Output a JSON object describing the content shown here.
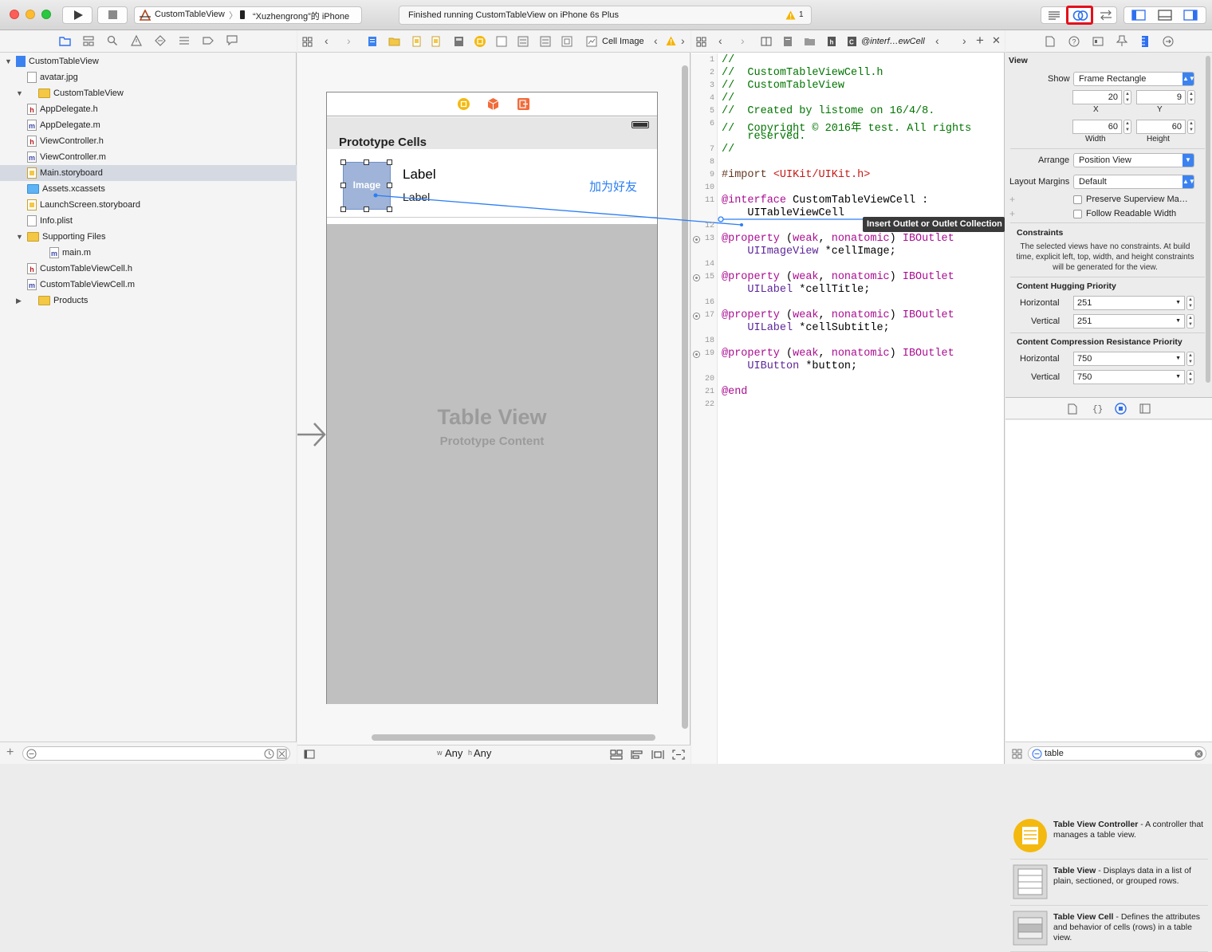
{
  "toolbar": {
    "scheme": "CustomTableView",
    "device": "“Xuzhengrong”的 iPhone",
    "activity": "Finished running CustomTableView on iPhone 6s Plus",
    "warning_count": "1",
    "assistant_highlight_color": "#e3101b"
  },
  "navigator": {
    "items": [
      {
        "label": "CustomTableView",
        "icon": "project-icon",
        "level": 0,
        "selected": false,
        "disclosure": "open"
      },
      {
        "label": "avatar.jpg",
        "icon": "image-file-icon",
        "level": 2
      },
      {
        "label": "CustomTableView",
        "icon": "folder-icon",
        "level": 1,
        "disclosure": "open"
      },
      {
        "label": "AppDelegate.h",
        "icon": "header-file-icon",
        "level": 2
      },
      {
        "label": "AppDelegate.m",
        "icon": "implementation-file-icon",
        "level": 2
      },
      {
        "label": "ViewController.h",
        "icon": "header-file-icon",
        "level": 2
      },
      {
        "label": "ViewController.m",
        "icon": "implementation-file-icon",
        "level": 2
      },
      {
        "label": "Main.storyboard",
        "icon": "storyboard-file-icon",
        "level": 2,
        "selected": true
      },
      {
        "label": "Assets.xcassets",
        "icon": "assets-folder-icon",
        "level": 2
      },
      {
        "label": "LaunchScreen.storyboard",
        "icon": "storyboard-file-icon",
        "level": 2
      },
      {
        "label": "Info.plist",
        "icon": "plist-file-icon",
        "level": 2
      },
      {
        "label": "Supporting Files",
        "icon": "folder-icon",
        "level": 2,
        "disclosure": "open"
      },
      {
        "label": "main.m",
        "icon": "implementation-file-icon",
        "level": 3
      },
      {
        "label": "CustomTableViewCell.h",
        "icon": "header-file-icon",
        "level": 2
      },
      {
        "label": "CustomTableViewCell.m",
        "icon": "implementation-file-icon",
        "level": 2
      },
      {
        "label": "Products",
        "icon": "folder-icon",
        "level": 1,
        "disclosure": "closed"
      }
    ]
  },
  "storyboard": {
    "jump_label": "Cell Image",
    "section_header": "Prototype Cells",
    "image_label": "Image",
    "cell_title": "Label",
    "cell_subtitle": "Label",
    "cell_button": "加为好友",
    "placeholder_title": "Table View",
    "placeholder_subtitle": "Prototype Content",
    "size_class_w": "Any",
    "size_class_h": "Any",
    "size_w_prefix": "w",
    "size_h_prefix": "h"
  },
  "code_editor": {
    "jump_label": "@interf…ewCell",
    "tooltip": "Insert Outlet or Outlet Collection",
    "lines": [
      {
        "n": "1",
        "text": "//"
      },
      {
        "n": "2",
        "text": "//  CustomTableViewCell.h"
      },
      {
        "n": "3",
        "text": "//  CustomTableView"
      },
      {
        "n": "4",
        "text": "//"
      },
      {
        "n": "5",
        "text": "//  Created by listome on 16/4/8."
      },
      {
        "n": "6",
        "text": "//  Copyright © 2016年 test. All rights"
      },
      {
        "n": "",
        "text": "    reserved."
      },
      {
        "n": "7",
        "text": "//"
      },
      {
        "n": "8",
        "text": ""
      },
      {
        "n": "9",
        "text": "#import <UIKit/UIKit.h>"
      },
      {
        "n": "10",
        "text": ""
      },
      {
        "n": "11",
        "text": "@interface CustomTableViewCell :"
      },
      {
        "n": "",
        "text": "    UITableViewCell"
      },
      {
        "n": "12",
        "text": ""
      },
      {
        "n": "13",
        "text": "@property (weak, nonatomic) IBOutlet"
      },
      {
        "n": "",
        "text": "    UIImageView *cellImage;"
      },
      {
        "n": "14",
        "text": ""
      },
      {
        "n": "15",
        "text": "@property (weak, nonatomic) IBOutlet"
      },
      {
        "n": "",
        "text": "    UILabel *cellTitle;"
      },
      {
        "n": "16",
        "text": ""
      },
      {
        "n": "17",
        "text": "@property (weak, nonatomic) IBOutlet"
      },
      {
        "n": "",
        "text": "    UILabel *cellSubtitle;"
      },
      {
        "n": "18",
        "text": ""
      },
      {
        "n": "19",
        "text": "@property (weak, nonatomic) IBOutlet"
      },
      {
        "n": "",
        "text": "    UIButton *button;"
      },
      {
        "n": "20",
        "text": ""
      },
      {
        "n": "21",
        "text": "@end"
      },
      {
        "n": "22",
        "text": ""
      }
    ]
  },
  "inspector": {
    "section": "View",
    "show_label": "Show",
    "show_value": "Frame Rectangle",
    "x_value": "20",
    "y_value": "9",
    "x_label": "X",
    "y_label": "Y",
    "width_value": "60",
    "height_value": "60",
    "width_label": "Width",
    "height_label": "Height",
    "arrange_label": "Arrange",
    "arrange_value": "Position View",
    "margins_label": "Layout Margins",
    "margins_value": "Default",
    "preserve_label": "Preserve Superview Ma…",
    "readable_label": "Follow Readable Width",
    "constraints_title": "Constraints",
    "constraints_text": "The selected views have no constraints. At build time, explicit left, top, width, and height constraints will be generated for the view.",
    "hugging_title": "Content Hugging Priority",
    "horizontal_label": "Horizontal",
    "vertical_label": "Vertical",
    "hugging_h": "251",
    "hugging_v": "251",
    "compression_title": "Content Compression Resistance Priority",
    "compression_h": "750",
    "compression_v": "750"
  },
  "library": {
    "items": [
      {
        "title": "Table View Controller",
        "desc": " - A controller that manages a table view.",
        "icon": "table-view-controller-icon"
      },
      {
        "title": "Table View",
        "desc": " - Displays data in a list of plain, sectioned, or grouped rows.",
        "icon": "table-view-icon"
      },
      {
        "title": "Table View Cell",
        "desc": " - Defines the attributes and behavior of cells (rows) in a table view.",
        "icon": "table-view-cell-icon"
      }
    ],
    "filter_value": "table"
  }
}
